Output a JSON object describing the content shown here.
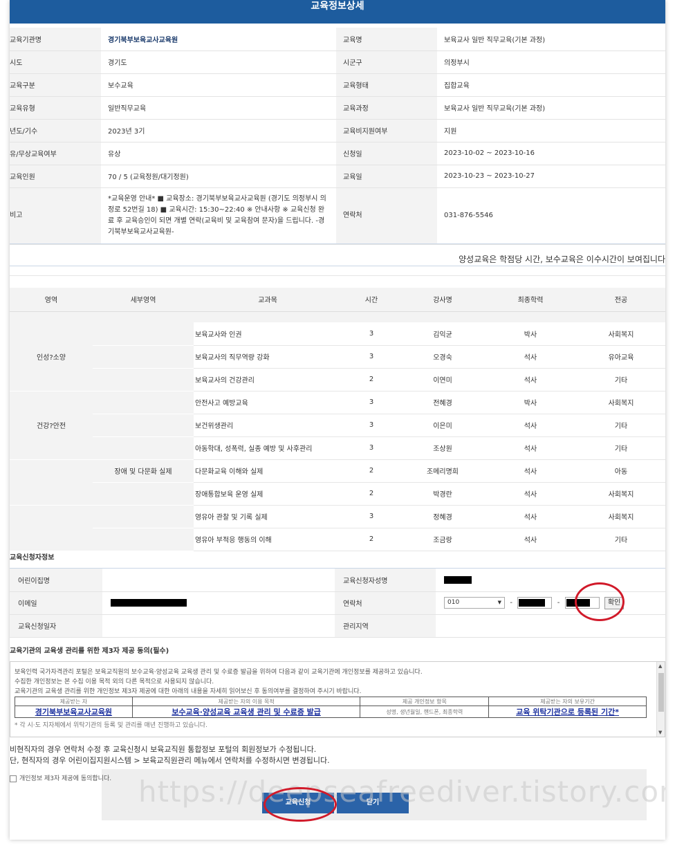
{
  "title": "교육정보상세",
  "info_rows": [
    {
      "l1": "교육기관명",
      "v1": "경기북부보육교사교육원",
      "l2": "교육명",
      "v2": "보육교사 일반 직무교육(기본 과정)"
    },
    {
      "l1": "시도",
      "v1": "경기도",
      "l2": "시군구",
      "v2": "의정부시"
    },
    {
      "l1": "교육구분",
      "v1": "보수교육",
      "l2": "교육형태",
      "v2": "집합교육"
    },
    {
      "l1": "교육유형",
      "v1": "일반직무교육",
      "l2": "교육과정",
      "v2": "보육교사 일반 직무교육(기본 과정)"
    },
    {
      "l1": "년도/기수",
      "v1": "2023년 3기",
      "l2": "교육비지원여부",
      "v2": "지원"
    },
    {
      "l1": "유/무상교육여부",
      "v1": "유상",
      "l2": "신청일",
      "v2": "2023-10-02 ~ 2023-10-16"
    },
    {
      "l1": "교육인원",
      "v1": "70 / 5 (교육정원/대기정원)",
      "l2": "교육일",
      "v2": "2023-10-23 ~ 2023-10-27"
    },
    {
      "l1": "비고",
      "v1": "*교육운영 안내* ■ 교육장소: 경기북부보육교사교육원 (경기도 의정부시 의정로 52번길 18) ■ 교육시간: 15:30~22:40 ※ 안내사항 ※ 교육신청 완료 후 교육승인이 되면 개별 연락(교육비 및 교육참여 문자)을 드립니다. -경기북부보육교사교육원-",
      "l2": "연락처",
      "v2": "031-876-5546"
    }
  ],
  "notice": "양성교육은 학점당 시간, 보수교육은 이수시간이 보여집니다",
  "curriculum": {
    "headers": [
      "영역",
      "세부영역",
      "교과목",
      "시간",
      "강사명",
      "최종학력",
      "전공"
    ],
    "groups": [
      {
        "area": "인성?소양",
        "sub": "",
        "rows": [
          {
            "subject": "보육교사와 인권",
            "hours": "3",
            "teacher": "김익균",
            "degree": "박사",
            "major": "사회복지"
          },
          {
            "subject": "보육교사의 직무역량 강화",
            "hours": "3",
            "teacher": "오경숙",
            "degree": "석사",
            "major": "유아교육"
          },
          {
            "subject": "보육교사의 건강관리",
            "hours": "2",
            "teacher": "이연미",
            "degree": "석사",
            "major": "기타"
          }
        ]
      },
      {
        "area": "건강?안전",
        "sub": "",
        "rows": [
          {
            "subject": "안전사고 예방교육",
            "hours": "3",
            "teacher": "전혜경",
            "degree": "박사",
            "major": "사회복지"
          },
          {
            "subject": "보건위생관리",
            "hours": "3",
            "teacher": "이은미",
            "degree": "석사",
            "major": "기타"
          },
          {
            "subject": "아동학대, 성폭력, 실종 예방 및 사후관리",
            "hours": "3",
            "teacher": "조상원",
            "degree": "석사",
            "major": "기타"
          }
        ]
      },
      {
        "area": "",
        "sub": "장애 및 다문화 실제",
        "rows": [
          {
            "subject": "다문화교육 이해와 실제",
            "hours": "2",
            "teacher": "조메리명희",
            "degree": "석사",
            "major": "아동"
          },
          {
            "subject": "장애통합보육 운영 실제",
            "hours": "2",
            "teacher": "박경란",
            "degree": "석사",
            "major": "사회복지"
          }
        ]
      },
      {
        "area": "",
        "sub": "",
        "rows": [
          {
            "subject": "영유아 관찰 및 기록 실제",
            "hours": "3",
            "teacher": "정혜경",
            "degree": "석사",
            "major": "사회복지"
          },
          {
            "subject": "영유아 부적응 행동의 이해",
            "hours": "2",
            "teacher": "조금랑",
            "degree": "석사",
            "major": "기타"
          }
        ]
      }
    ]
  },
  "applicant": {
    "section_title": "교육신청자정보",
    "daycare_label": "어린이집명",
    "daycare_value": "",
    "name_label": "교육신청자성명",
    "email_label": "이메일",
    "phone_label": "연락처",
    "phone_prefix": "010",
    "confirm_label": "확인",
    "apply_date_label": "교육신청일자",
    "apply_date_value": "",
    "region_label": "관리지역",
    "region_value": ""
  },
  "consent": {
    "section_title": "교육기관의 교육생 관리를 위한 제3자 제공 동의(필수)",
    "line1": "보육인력 국가자격관리 포털은 보육교직원의 보수교육·양성교육 교육생 관리 및 수료증 발급을 위하여 다음과 같이 교육기관에 개인정보를 제공하고 있습니다.",
    "line2": "수집한 개인정보는 본 수집 이용 목적 외의 다른 목적으로 사용되지 않습니다.",
    "line3": "교육기관의 교육생 관리를 위한 개인정보 제3자 제공에 대한 아래의 내용을 자세히 읽어보신 후 동의여부를 결정하여 주시기 바랍니다.",
    "headers": [
      "제공받는 자",
      "제공받는 자의 이용 목적",
      "제공 개인정보 항목",
      "제공받는 자의 보유기간"
    ],
    "values": [
      "경기북부보육교사교육원",
      "보수교육·양성교육 교육생 관리 및 수료증 발급",
      "성명, 생년월일, 핸드폰, 최종학력",
      "교육 위탁기관으로 등록된 기간*"
    ],
    "footnote": "* 각 시·도 지자체에서 위탁기관의 등록 및 관리를 매년 진행하고 있습니다."
  },
  "notes": [
    "비현직자의 경우 연락처 수정 후 교육신청시 보육교직원 통합정보 포털의 회원정보가 수정됩니다.",
    "단, 현직자의 경우 어린이집지원시스템 > 보육교직원관리 메뉴에서 연락처를 수정하시면 변경됩니다."
  ],
  "agree_label": "개인정보 제3자 제공에 동의합니다.",
  "buttons": {
    "apply": "교육신청",
    "close": "닫기"
  },
  "watermark": "https://deepseafreediver.tistory.com",
  "colors": {
    "title_bg": "#1d5c9e",
    "button_bg": "#2b63a8",
    "highlight": "#d11a2a"
  }
}
